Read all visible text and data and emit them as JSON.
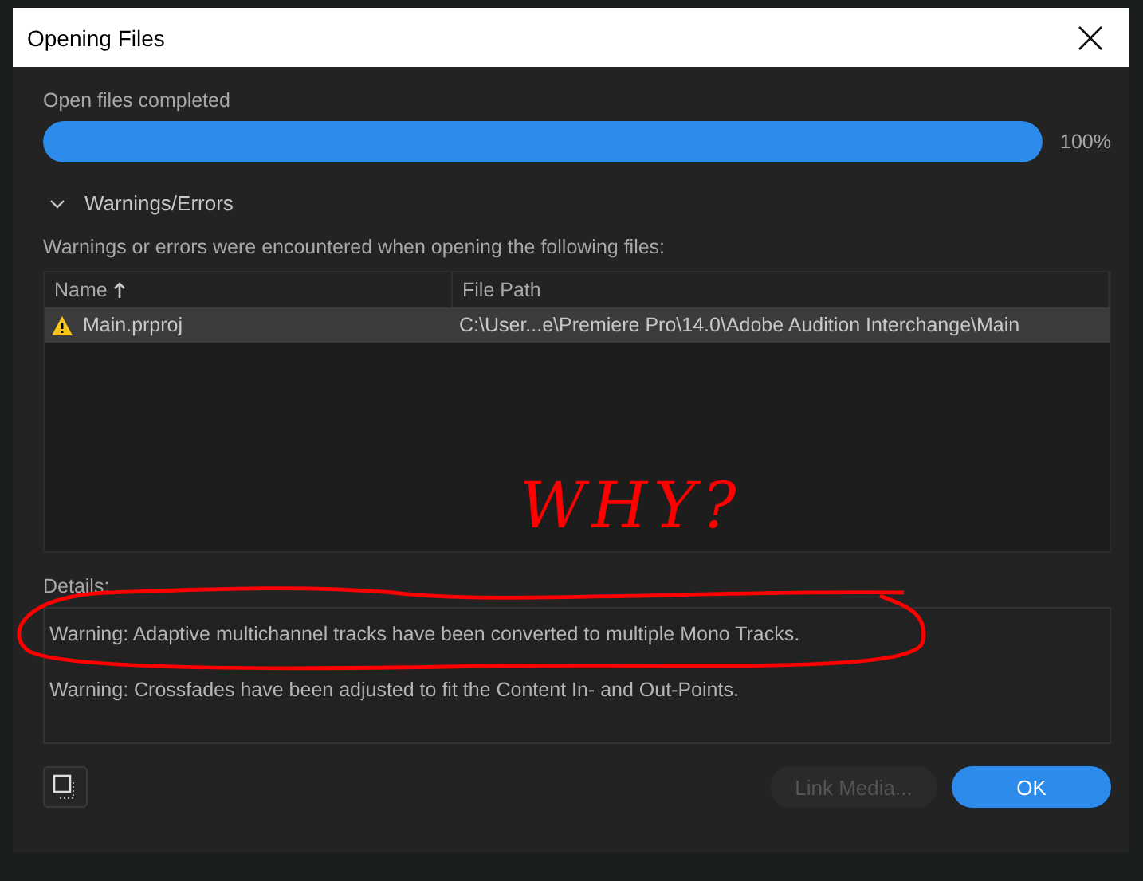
{
  "window": {
    "title": "Opening Files"
  },
  "progress": {
    "label": "Open files completed",
    "level": 1,
    "reading": "100%"
  },
  "section": {
    "title": "Warnings/Errors",
    "expanded": true,
    "description": "Warnings or errors were encountered when opening the following files:"
  },
  "table": {
    "columns": [
      {
        "label": "Name",
        "sorted": true
      },
      {
        "label": "File Path",
        "sorted": false
      }
    ],
    "rows": [
      {
        "name": "Main.prproj",
        "path": "C:\\User...e\\Premiere Pro\\14.0\\Adobe Audition Interchange\\Main",
        "warning": true,
        "selected": true
      }
    ]
  },
  "details": {
    "label": "Details:",
    "lines": [
      {
        "text": "Warning: Adaptive multichannel tracks have been converted to multiple Mono Tracks.",
        "circled": true
      },
      {
        "text": "Warning: Crossfades have been adjusted to fit the Content In- and Out-Points.",
        "circled": false
      }
    ]
  },
  "annotation": {
    "text": "WHY?",
    "color": "#ff0000"
  },
  "buttons": [
    {
      "label": "Link Media...",
      "kind": "secondary",
      "disabled": true
    },
    {
      "label": "OK",
      "kind": "primary",
      "disabled": false
    }
  ]
}
